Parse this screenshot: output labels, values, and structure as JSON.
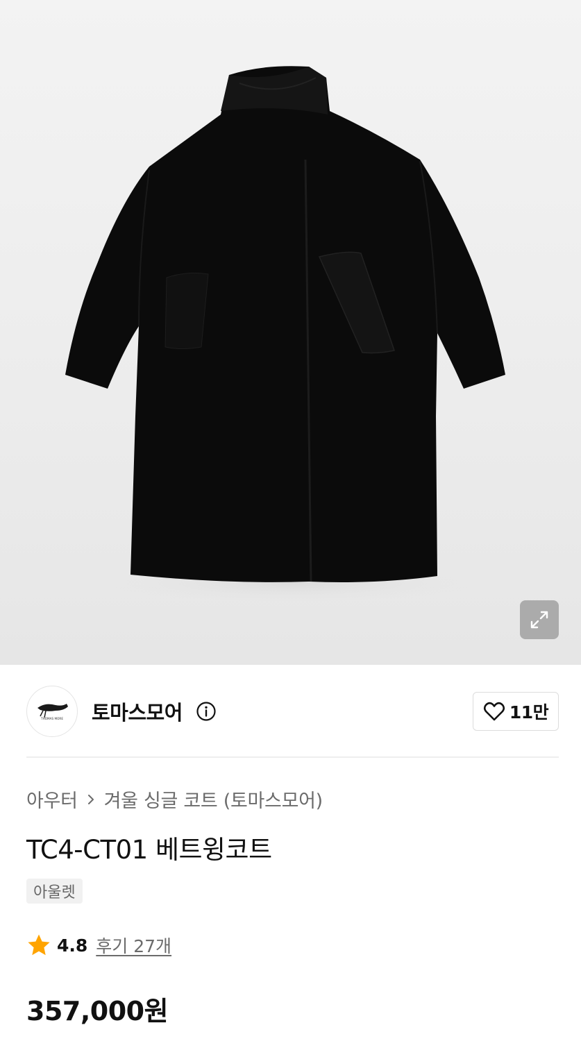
{
  "product_image": {
    "alt": "black wing coat",
    "zoom_icon": "expand-icon"
  },
  "brand": {
    "name": "토마스모어",
    "logo_text": "THOMAS MORE",
    "info_icon": "info-icon",
    "like_icon": "heart-icon",
    "like_count": "11만"
  },
  "breadcrumb": {
    "root": "아우터",
    "category": "겨울 싱글 코트 (토마스모어)"
  },
  "product": {
    "title": "TC4-CT01 베트윙코트",
    "tag": "아울렛",
    "rating": "4.8",
    "review_link": "후기 27개",
    "price": "357,000원"
  },
  "colors": {
    "star": "#ffa400",
    "text_primary": "#111111",
    "text_secondary": "#6b6b6b"
  }
}
